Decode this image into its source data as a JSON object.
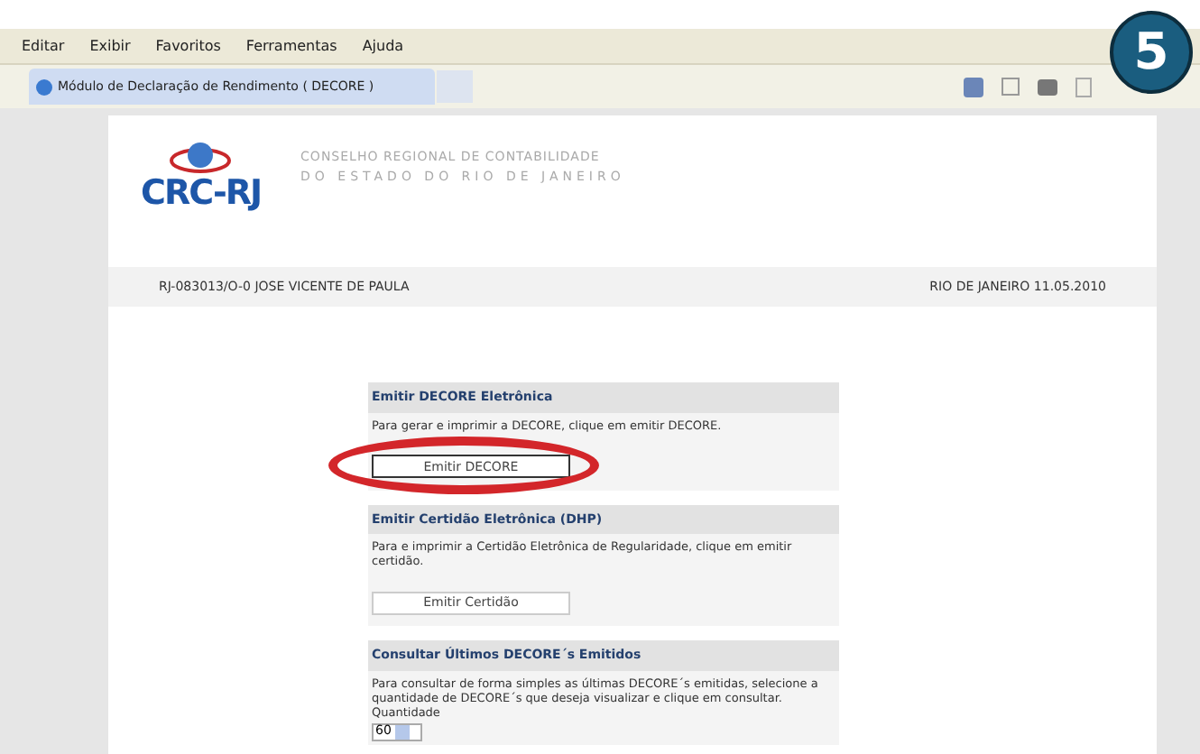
{
  "menu_bar": [
    "Editar",
    "Exibir",
    "Favoritos",
    "Ferramentas",
    "Ajuda"
  ],
  "tab": {
    "title": "Módulo de Declaração de Rendimento ( DECORE )",
    "selected": true
  },
  "step_badge": "5",
  "header": {
    "logo": "CRC-RJ",
    "org_line_1": "CONSELHO REGIONAL DE CONTABILIDADE",
    "org_line_2": "DO ESTADO DO RIO DE JANEIRO"
  },
  "user_bar": {
    "user": "RJ-083013/O-0 JOSE VICENTE DE PAULA",
    "location_date": "RIO DE JANEIRO 11.05.2010"
  },
  "sections": [
    {
      "title": "Emitir DECORE Eletrônica",
      "text": "Para gerar e imprimir a DECORE, clique em emitir DECORE.",
      "button": "Emitir DECORE",
      "highlighted": true
    },
    {
      "title": "Emitir Certidão Eletrônica (DHP)",
      "text": "Para e imprimir a Certidão Eletrônica de Regularidade, clique em emitir certidão.",
      "button": "Emitir Certidão",
      "highlighted": false
    },
    {
      "title": "Consultar Últimos DECORE´s Emitidos",
      "text": "Para consultar de forma simples as últimas DECORE´s emitidas, selecione a quantidade de DECORE´s que deseja visualizar e clique em consultar. Quantidade",
      "select": "60",
      "highlighted": false
    }
  ]
}
